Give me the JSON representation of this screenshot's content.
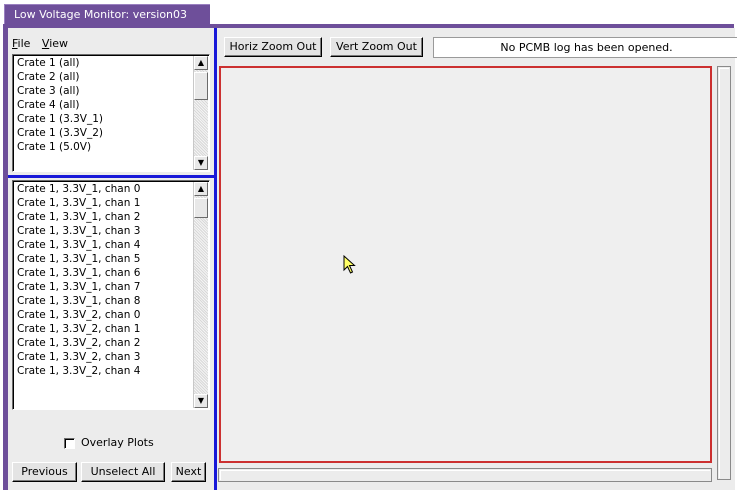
{
  "window": {
    "title": "Low Voltage Monitor: version03"
  },
  "menu": {
    "file": {
      "mnemonic": "F",
      "rest": "ile"
    },
    "view": {
      "mnemonic": "V",
      "rest": "iew"
    }
  },
  "crate_list": {
    "items": [
      "Crate 1 (all)",
      "Crate 2 (all)",
      "Crate 3 (all)",
      "Crate 4 (all)",
      "Crate 1 (3.3V_1)",
      "Crate 1 (3.3V_2)",
      "Crate 1 (5.0V)"
    ]
  },
  "channel_list": {
    "items": [
      "Crate 1, 3.3V_1, chan 0",
      "Crate 1, 3.3V_1, chan 1",
      "Crate 1, 3.3V_1, chan 2",
      "Crate 1, 3.3V_1, chan 3",
      "Crate 1, 3.3V_1, chan 4",
      "Crate 1, 3.3V_1, chan 5",
      "Crate 1, 3.3V_1, chan 6",
      "Crate 1, 3.3V_1, chan 7",
      "Crate 1, 3.3V_1, chan 8",
      "Crate 1, 3.3V_2, chan 0",
      "Crate 1, 3.3V_2, chan 1",
      "Crate 1, 3.3V_2, chan 2",
      "Crate 1, 3.3V_2, chan 3",
      "Crate 1, 3.3V_2, chan 4"
    ]
  },
  "overlay": {
    "label": "Overlay Plots",
    "checked": false
  },
  "buttons": {
    "previous": "Previous",
    "unselect_all": "Unselect All",
    "next": "Next",
    "horiz_zoom_out": "Horiz Zoom Out",
    "vert_zoom_out": "Vert Zoom Out"
  },
  "status": {
    "message": "No PCMB log has been opened."
  },
  "colors": {
    "frame": "#6e4f9a",
    "separator": "#1818d8",
    "plot_border": "#cc3030",
    "cursor_fill": "#ffff66"
  },
  "icons": {
    "scroll_up": "up-arrow-icon",
    "scroll_down": "down-arrow-icon",
    "pointer": "mouse-pointer-icon"
  }
}
